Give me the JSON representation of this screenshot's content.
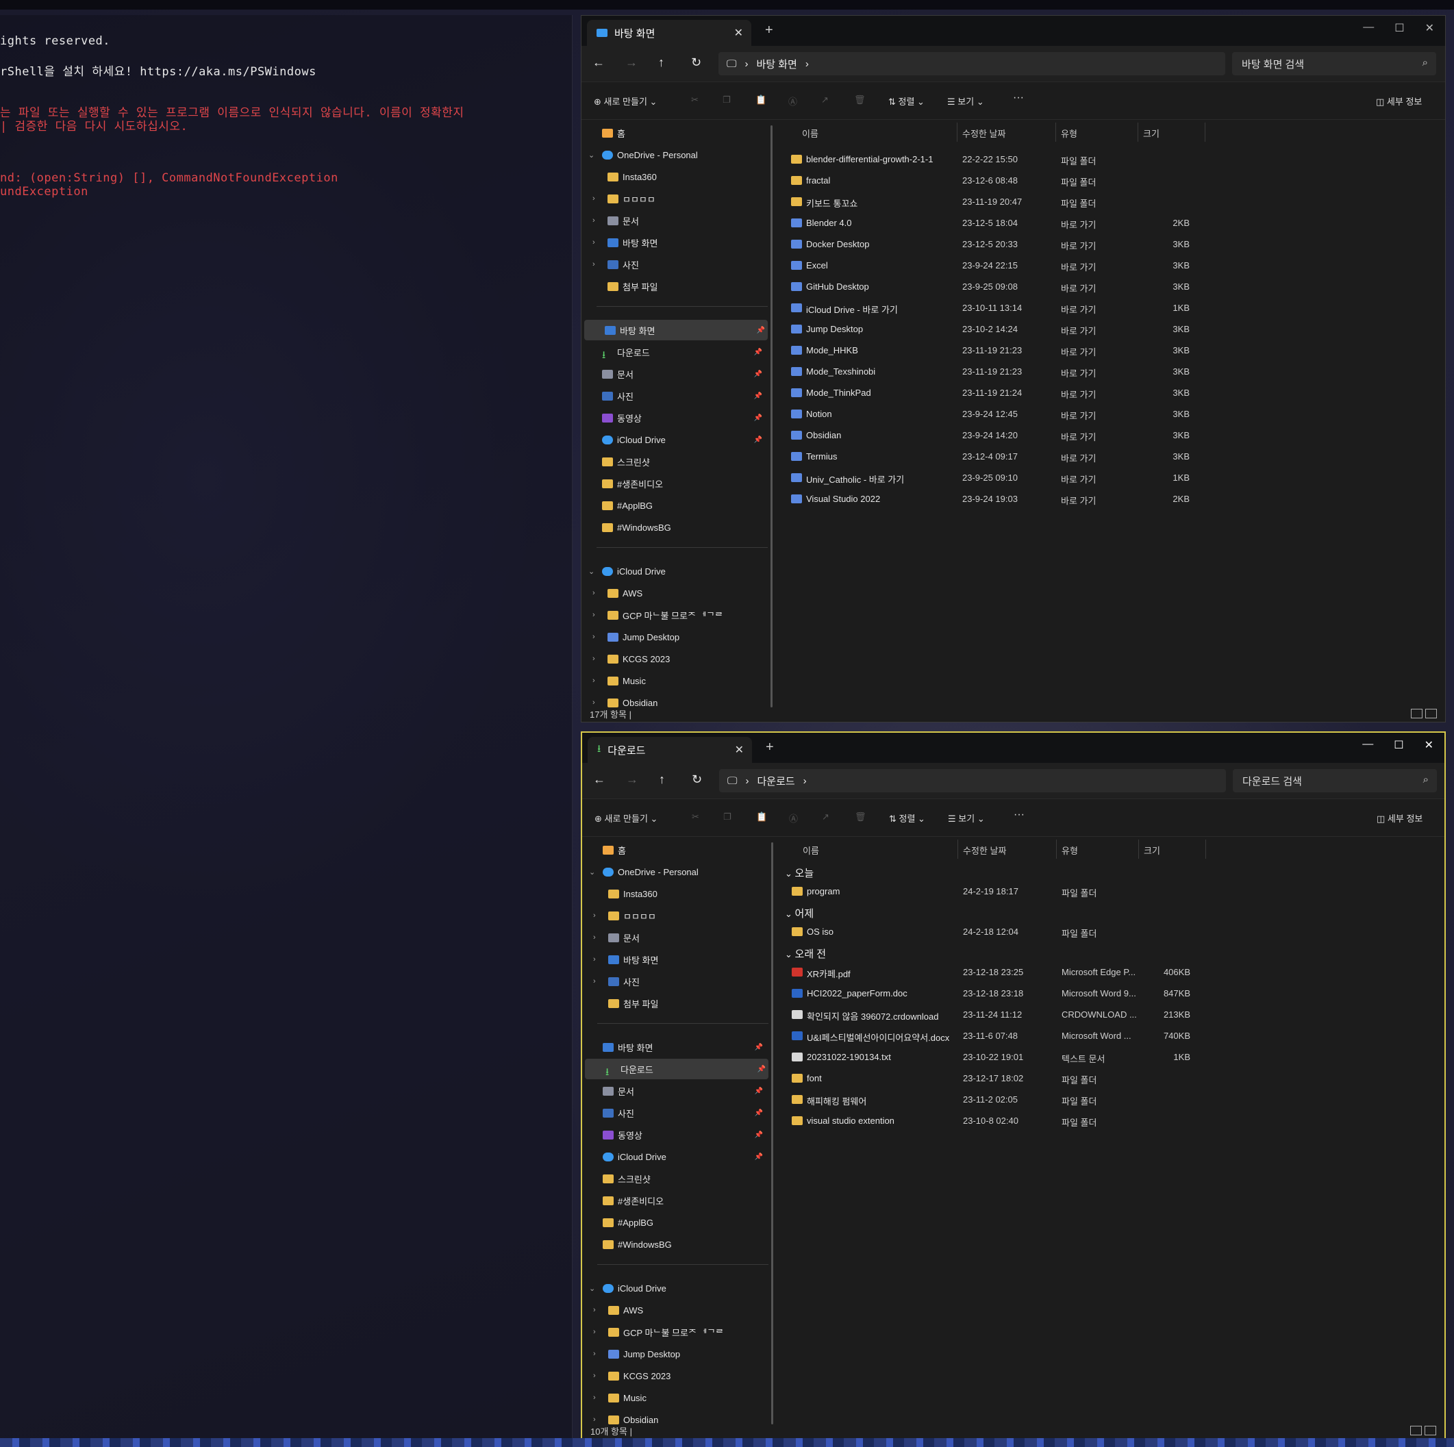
{
  "terminal": {
    "lines": [
      {
        "text": "ights reserved.",
        "color": "white"
      },
      {
        "text": "rShell을 설치 하세요! https://aka.ms/PSWindows",
        "color": "white"
      },
      {
        "text": "는 파일 또는 실행할 수 있는 프로그램 이름으로 인식되지 않습니다. 이름이 정확한지",
        "color": "red"
      },
      {
        "text": "| 검증한 다음 다시 시도하십시오.",
        "color": "red"
      },
      {
        "text": "nd: (open:String) [], CommandNotFoundException",
        "color": "red"
      },
      {
        "text": "undException",
        "color": "red"
      }
    ]
  },
  "explorer_top": {
    "tab_label": "바탕 화면",
    "address": "바탕 화면",
    "search_placeholder": "바탕 화면 검색",
    "commands": {
      "new": "새로 만들기",
      "sort": "정렬",
      "view": "보기",
      "more": "···",
      "details": "세부 정보"
    },
    "columns": {
      "name": "이름",
      "modified": "수정한 날짜",
      "type": "유형",
      "size": "크기"
    },
    "status": "17개 항목  |",
    "files": [
      {
        "name": "blender-differential-growth-2-1-1",
        "modified": "22-2-22 15:50",
        "type": "파일 폴더",
        "size": "",
        "icon": "folder"
      },
      {
        "name": "fractal",
        "modified": "23-12-6 08:48",
        "type": "파일 폴더",
        "size": "",
        "icon": "folder"
      },
      {
        "name": "키보드 통꼬쇼",
        "modified": "23-11-19 20:47",
        "type": "파일 폴더",
        "size": "",
        "icon": "folder"
      },
      {
        "name": "Blender 4.0",
        "modified": "23-12-5 18:04",
        "type": "바로 가기",
        "size": "2KB",
        "icon": "shortcut"
      },
      {
        "name": "Docker Desktop",
        "modified": "23-12-5 20:33",
        "type": "바로 가기",
        "size": "3KB",
        "icon": "shortcut"
      },
      {
        "name": "Excel",
        "modified": "23-9-24 22:15",
        "type": "바로 가기",
        "size": "3KB",
        "icon": "shortcut"
      },
      {
        "name": "GitHub Desktop",
        "modified": "23-9-25 09:08",
        "type": "바로 가기",
        "size": "3KB",
        "icon": "shortcut"
      },
      {
        "name": "iCloud Drive - 바로 가기",
        "modified": "23-10-11 13:14",
        "type": "바로 가기",
        "size": "1KB",
        "icon": "shortcut"
      },
      {
        "name": "Jump Desktop",
        "modified": "23-10-2 14:24",
        "type": "바로 가기",
        "size": "3KB",
        "icon": "shortcut"
      },
      {
        "name": "Mode_HHKB",
        "modified": "23-11-19 21:23",
        "type": "바로 가기",
        "size": "3KB",
        "icon": "shortcut"
      },
      {
        "name": "Mode_Texshinobi",
        "modified": "23-11-19 21:23",
        "type": "바로 가기",
        "size": "3KB",
        "icon": "shortcut"
      },
      {
        "name": "Mode_ThinkPad",
        "modified": "23-11-19 21:24",
        "type": "바로 가기",
        "size": "3KB",
        "icon": "shortcut"
      },
      {
        "name": "Notion",
        "modified": "23-9-24 12:45",
        "type": "바로 가기",
        "size": "3KB",
        "icon": "shortcut"
      },
      {
        "name": "Obsidian",
        "modified": "23-9-24 14:20",
        "type": "바로 가기",
        "size": "3KB",
        "icon": "shortcut"
      },
      {
        "name": "Termius",
        "modified": "23-12-4 09:17",
        "type": "바로 가기",
        "size": "3KB",
        "icon": "shortcut"
      },
      {
        "name": "Univ_Catholic - 바로 가기",
        "modified": "23-9-25 09:10",
        "type": "바로 가기",
        "size": "1KB",
        "icon": "shortcut"
      },
      {
        "name": "Visual Studio 2022",
        "modified": "23-9-24 19:03",
        "type": "바로 가기",
        "size": "2KB",
        "icon": "shortcut"
      }
    ]
  },
  "explorer_bottom": {
    "tab_label": "다운로드",
    "address": "다운로드",
    "search_placeholder": "다운로드 검색",
    "commands": {
      "new": "새로 만들기",
      "sort": "정렬",
      "view": "보기",
      "more": "···",
      "details": "세부 정보"
    },
    "columns": {
      "name": "이름",
      "modified": "수정한 날짜",
      "type": "유형",
      "size": "크기"
    },
    "status": "10개 항목  |",
    "groups": [
      {
        "label": "오늘",
        "files": [
          {
            "name": "program",
            "modified": "24-2-19 18:17",
            "type": "파일 폴더",
            "size": "",
            "icon": "folder"
          }
        ]
      },
      {
        "label": "어제",
        "files": [
          {
            "name": "OS iso",
            "modified": "24-2-18 12:04",
            "type": "파일 폴더",
            "size": "",
            "icon": "folder"
          }
        ]
      },
      {
        "label": "오래 전",
        "files": [
          {
            "name": "XR카페.pdf",
            "modified": "23-12-18 23:25",
            "type": "Microsoft Edge P...",
            "size": "406KB",
            "icon": "pdf"
          },
          {
            "name": "HCI2022_paperForm.doc",
            "modified": "23-12-18 23:18",
            "type": "Microsoft Word 9...",
            "size": "847KB",
            "icon": "word"
          },
          {
            "name": "확인되지 않음 396072.crdownload",
            "modified": "23-11-24 11:12",
            "type": "CRDOWNLOAD ...",
            "size": "213KB",
            "icon": "file"
          },
          {
            "name": "U&I페스티벌예선아이디어요약서.docx",
            "modified": "23-11-6 07:48",
            "type": "Microsoft Word ...",
            "size": "740KB",
            "icon": "word"
          },
          {
            "name": "20231022-190134.txt",
            "modified": "23-10-22 19:01",
            "type": "텍스트 문서",
            "size": "1KB",
            "icon": "file"
          },
          {
            "name": "font",
            "modified": "23-12-17 18:02",
            "type": "파일 폴더",
            "size": "",
            "icon": "folder"
          },
          {
            "name": "해피해킹 펌웨어",
            "modified": "23-11-2 02:05",
            "type": "파일 폴더",
            "size": "",
            "icon": "folder"
          },
          {
            "name": "visual studio extention",
            "modified": "23-10-8 02:40",
            "type": "파일 폴더",
            "size": "",
            "icon": "folder"
          }
        ]
      }
    ]
  },
  "sidebar": {
    "items": [
      {
        "label": "홈",
        "icon": "home",
        "indent": 0,
        "chev": "",
        "pin": false
      },
      {
        "label": "OneDrive - Personal",
        "icon": "cloud",
        "indent": 0,
        "chev": "v",
        "pin": false
      },
      {
        "label": "Insta360",
        "icon": "folder",
        "indent": 1,
        "chev": "",
        "pin": false
      },
      {
        "label": "ㅁㅁㅁㅁ",
        "icon": "folder",
        "indent": 1,
        "chev": ">",
        "pin": false
      },
      {
        "label": "문서",
        "icon": "doc",
        "indent": 1,
        "chev": ">",
        "pin": false
      },
      {
        "label": "바탕 화면",
        "icon": "desktop",
        "indent": 1,
        "chev": ">",
        "pin": false
      },
      {
        "label": "사진",
        "icon": "pic",
        "indent": 1,
        "chev": ">",
        "pin": false
      },
      {
        "label": "첨부 파일",
        "icon": "folder",
        "indent": 1,
        "chev": "",
        "pin": false
      },
      {
        "sep": true
      },
      {
        "label": "바탕 화면",
        "icon": "desktop",
        "indent": 0,
        "chev": "",
        "pin": true
      },
      {
        "label": "다운로드",
        "icon": "download",
        "indent": 0,
        "chev": "",
        "pin": true
      },
      {
        "label": "문서",
        "icon": "doc",
        "indent": 0,
        "chev": "",
        "pin": true
      },
      {
        "label": "사진",
        "icon": "pic",
        "indent": 0,
        "chev": "",
        "pin": true
      },
      {
        "label": "동영상",
        "icon": "vid",
        "indent": 0,
        "chev": "",
        "pin": true
      },
      {
        "label": "iCloud Drive",
        "icon": "cloud",
        "indent": 0,
        "chev": "",
        "pin": true
      },
      {
        "label": "스크린샷",
        "icon": "folder",
        "indent": 0,
        "chev": "",
        "pin": false
      },
      {
        "label": "#생존비디오",
        "icon": "folder",
        "indent": 0,
        "chev": "",
        "pin": false
      },
      {
        "label": "#ApplBG",
        "icon": "folder",
        "indent": 0,
        "chev": "",
        "pin": false
      },
      {
        "label": "#WindowsBG",
        "icon": "folder",
        "indent": 0,
        "chev": "",
        "pin": false
      },
      {
        "sep": true
      },
      {
        "label": "iCloud Drive",
        "icon": "cloud",
        "indent": 0,
        "chev": "v",
        "pin": false
      },
      {
        "label": "AWS",
        "icon": "folder",
        "indent": 1,
        "chev": ">",
        "pin": false
      },
      {
        "label": "GCP 마ᄂ불 므로ᄌ ᅦᄀᄅ",
        "icon": "folder",
        "indent": 1,
        "chev": ">",
        "pin": false
      },
      {
        "label": "Jump Desktop",
        "icon": "shortcut",
        "indent": 1,
        "chev": ">",
        "pin": false
      },
      {
        "label": "KCGS 2023",
        "icon": "folder",
        "indent": 1,
        "chev": ">",
        "pin": false
      },
      {
        "label": "Music",
        "icon": "folder",
        "indent": 1,
        "chev": ">",
        "pin": false
      },
      {
        "label": "Obsidian",
        "icon": "folder",
        "indent": 1,
        "chev": ">",
        "pin": false
      }
    ]
  }
}
